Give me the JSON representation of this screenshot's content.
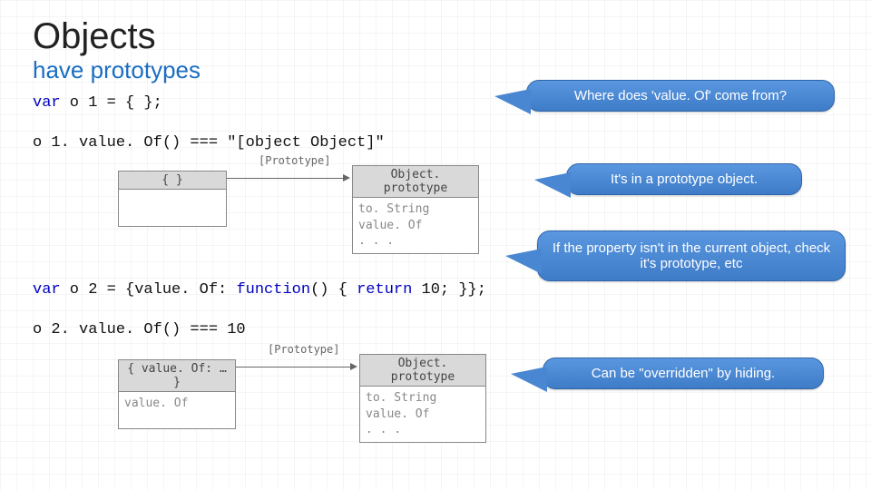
{
  "heading": {
    "title": "Objects",
    "subtitle": "have prototypes"
  },
  "code": {
    "kw_var": "var",
    "line1_rest": " o 1 = { };",
    "line2": "o 1. value. Of() === \"[object Object]\"",
    "line3_pre": " o 2 = {value. Of: ",
    "line3_fn": "function",
    "line3_mid": "() { ",
    "line3_ret": "return",
    "line3_post": " 10; }};",
    "line4": "o 2. value. Of() === 10"
  },
  "diagram1": {
    "left_box": {
      "head": "{ }",
      "body": ""
    },
    "proto_label": "[Prototype]",
    "right_box": {
      "head": "Object. prototype",
      "body": "to. String\nvalue. Of\n. . ."
    }
  },
  "diagram2": {
    "left_box": {
      "head": "{ value. Of: … }",
      "body": "value. Of"
    },
    "proto_label": "[Prototype]",
    "right_box": {
      "head": "Object. prototype",
      "body": "to. String\nvalue. Of\n. . ."
    }
  },
  "callouts": {
    "c1": "Where does 'value. Of' come from?",
    "c2": "It's in a prototype object.",
    "c3": "If the property isn't in the current object, check it's prototype, etc",
    "c4": "Can be \"overridden\" by hiding."
  }
}
